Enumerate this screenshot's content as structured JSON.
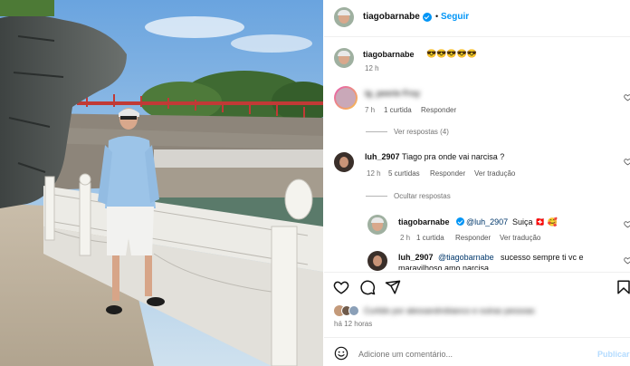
{
  "header": {
    "username": "tiagobarnabe",
    "separator": "•",
    "follow_label": "Seguir",
    "more_icon": "more-horizontal-icon"
  },
  "caption": {
    "username": "tiagobarnabe",
    "text": "😎😎😎😎😎",
    "time": "12 h"
  },
  "comments": [
    {
      "username": "ig_peerie Frsy",
      "text": "",
      "time": "7 h",
      "likes": "1 curtida",
      "reply": "Responder",
      "replies_toggle": "Ver respostas (4)"
    },
    {
      "username": "luh_2907",
      "text": "Tiago pra onde vai narcisa ?",
      "time": "12 h",
      "likes": "5 curtidas",
      "reply": "Responder",
      "translate": "Ver tradução",
      "replies_toggle": "Ocultar respostas",
      "replies": [
        {
          "username": "tiagobarnabe",
          "mention": "@luh_2907",
          "text": "Suiça 🇨🇭 🥰",
          "time": "2 h",
          "likes": "1 curtida",
          "reply": "Responder",
          "translate": "Ver tradução"
        },
        {
          "username": "luh_2907",
          "mention": "@tiagobarnabe",
          "text_line1": "sucesso sempre ti vc e",
          "text_line2": "maravilhoso amo narcisa"
        }
      ]
    }
  ],
  "actions": {
    "like_icon": "heart-icon",
    "comment_icon": "comment-icon",
    "share_icon": "send-icon",
    "save_icon": "bookmark-icon"
  },
  "liked_by": "Curtido por alessandrobianco e outras pessoas",
  "post_time": "há 12 horas",
  "composer": {
    "emoji_icon": "emoji-icon",
    "placeholder": "Adicione um comentário...",
    "publish_label": "Publicar"
  }
}
